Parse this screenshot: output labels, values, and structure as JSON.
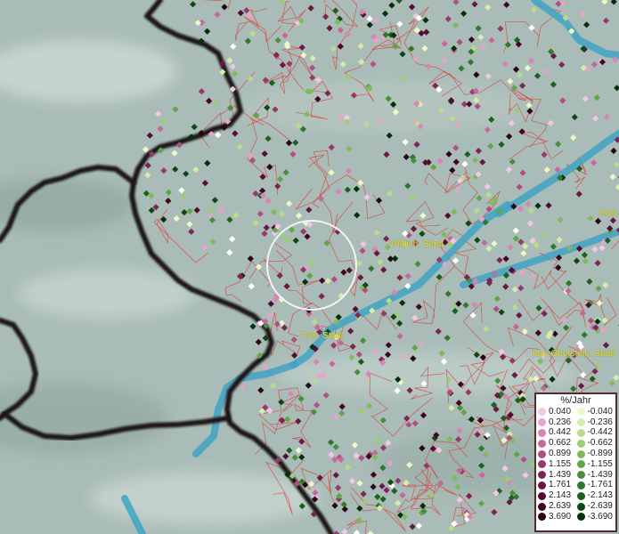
{
  "map": {
    "cities": [
      {
        "name": "Wittlich, Stadt"
      },
      {
        "name": "Trier, Stadt"
      },
      {
        "name": "Idar-Oberstein, Stadt"
      },
      {
        "name": "Kast"
      }
    ],
    "colors": {
      "terrain": "#a9bcb7",
      "border": "#1c1414",
      "admin_lines": "#e0332e",
      "water": "#3fa3c4"
    }
  },
  "legend": {
    "title": "%/Jahr",
    "positive": {
      "values": [
        "0.040",
        "0.236",
        "0.442",
        "0.662",
        "0.899",
        "1.155",
        "1.439",
        "1.761",
        "2.143",
        "2.639",
        "3.690"
      ],
      "colors": [
        "#f7c6e6",
        "#e8a3cc",
        "#d984b4",
        "#c8679b",
        "#b04f82",
        "#97396b",
        "#7f2555",
        "#6a1742",
        "#560c32",
        "#420624",
        "#2a0515"
      ]
    },
    "negative": {
      "values": [
        "-0.040",
        "-0.236",
        "-0.442",
        "-0.662",
        "-0.899",
        "-1.155",
        "-1.439",
        "-1.761",
        "-2.143",
        "-2.639",
        "-3.690"
      ],
      "colors": [
        "#eef7c7",
        "#d5ecaa",
        "#b8dd8a",
        "#9ccd72",
        "#7fba5c",
        "#62a548",
        "#478f3a",
        "#2f782c",
        "#1c6020",
        "#0e4915",
        "#05300c"
      ]
    }
  }
}
